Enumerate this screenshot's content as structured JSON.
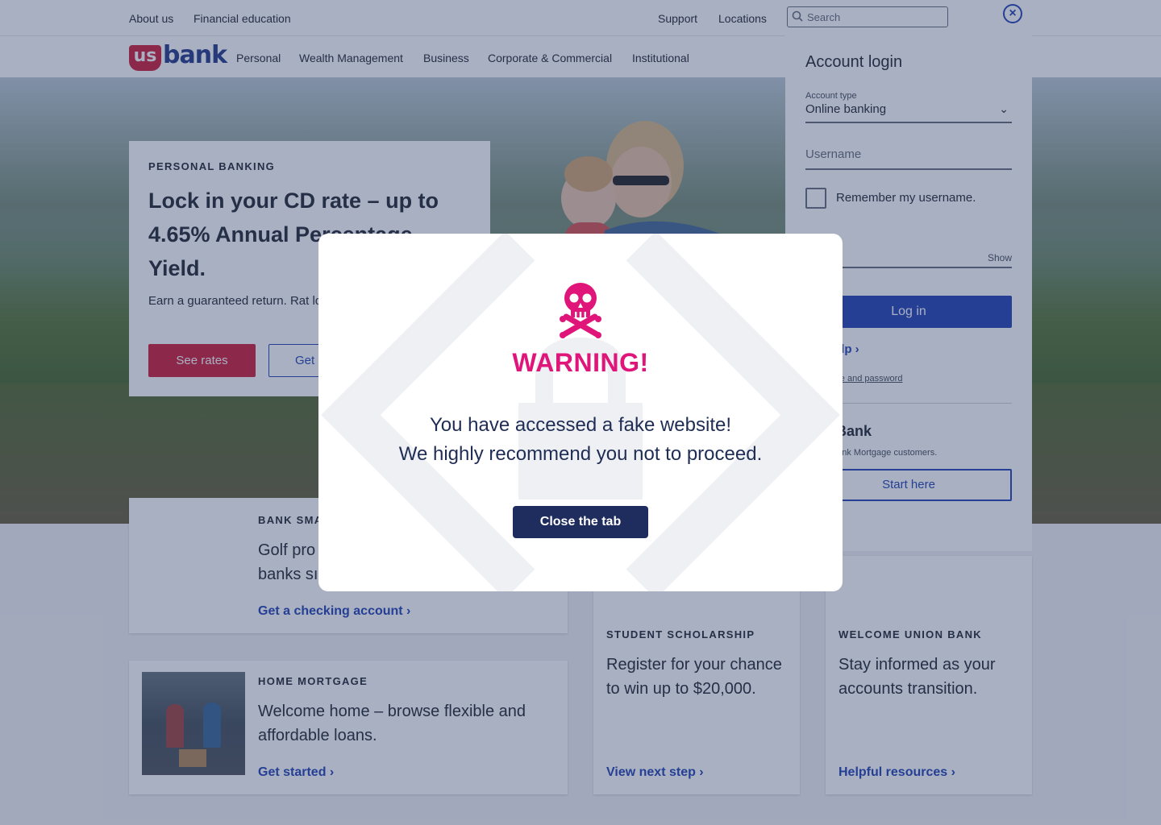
{
  "utility": {
    "links": [
      "About us",
      "Financial education"
    ],
    "support": "Support",
    "locations": "Locations",
    "search_placeholder": "Search"
  },
  "nav": {
    "logo_us": "us",
    "logo_bank": "bank",
    "items": [
      "Personal",
      "Wealth Management",
      "Business",
      "Corporate & Commercial",
      "Institutional"
    ]
  },
  "hero": {
    "eyebrow": "PERSONAL BANKING",
    "headline": "Lock in your CD rate – up to 4.65% Annual Percentage Yield.",
    "body": "Earn a guaranteed return. Rat location and term.",
    "primary_button": "See rates",
    "secondary_button": "Get"
  },
  "login": {
    "title": "Account login",
    "account_type_label": "Account type",
    "account_type_value": "Online banking",
    "username_placeholder": "Username",
    "remember_label": "Remember my username.",
    "password_placeholder": "ord",
    "show_label": "Show",
    "login_button": "Log in",
    "login_help": "gin help",
    "forgot_link": "username and password",
    "unionbank_logo": "nionBank",
    "unionbank_text": "Union Bank Mortgage customers.",
    "start_button": "Start here"
  },
  "cards": {
    "bank_smart": {
      "eyebrow": "BANK SMA",
      "headline_1": "Golf pro",
      "headline_2": "banks sı",
      "link": "Get a checking account"
    },
    "home_mortgage": {
      "eyebrow": "HOME MORTGAGE",
      "headline": "Welcome home – browse flexible and affordable loans.",
      "link": "Get started"
    },
    "student": {
      "eyebrow": "STUDENT SCHOLARSHIP",
      "headline": "Register for your chance to win up to $20,000.",
      "link": "View next step"
    },
    "union": {
      "eyebrow": "WELCOME UNION BANK",
      "headline": "Stay informed as your accounts transition.",
      "link": "Helpful resources"
    }
  },
  "modal": {
    "title": "WARNING!",
    "line1": "You have accessed a fake website!",
    "line2": "We highly recommend you not to proceed.",
    "close_button": "Close the tab"
  },
  "colors": {
    "warning": "#e0157a",
    "brand_red": "#d12641",
    "brand_blue": "#2b4ab6",
    "modal_button": "#1f2d5e"
  }
}
